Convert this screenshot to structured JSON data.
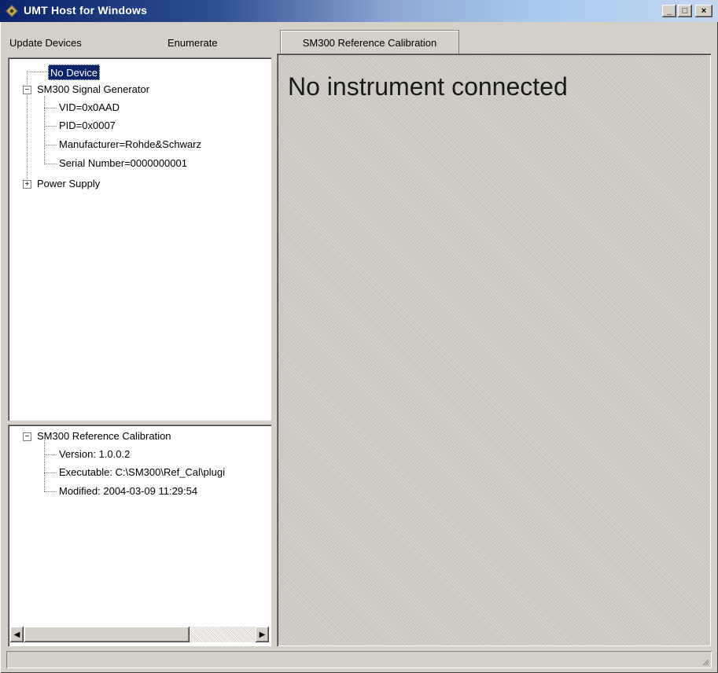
{
  "window": {
    "title": "UMT Host for Windows"
  },
  "title_buttons": {
    "minimize": "_",
    "maximize": "□",
    "close": "×"
  },
  "menu": {
    "update_devices": "Update Devices",
    "enumerate": "Enumerate"
  },
  "tabs": [
    {
      "label": "SM300 Reference Calibration",
      "active": true
    }
  ],
  "device_tree": {
    "selected": "No Device",
    "signal_generator": {
      "label": "SM300 Signal Generator",
      "expander": "−",
      "children": [
        "VID=0x0AAD",
        "PID=0x0007",
        "Manufacturer=Rohde&Schwarz",
        "Serial Number=0000000001"
      ]
    },
    "power_supply": {
      "label": "Power Supply",
      "expander": "+"
    }
  },
  "plugin_tree": {
    "label": "SM300 Reference Calibration",
    "expander": "−",
    "children": [
      "Version: 1.0.0.2",
      "Executable: C:\\SM300\\Ref_Cal\\plugi",
      "Modified: 2004-03-09 11:29:54"
    ]
  },
  "scrollbar": {
    "left_arrow": "◀",
    "right_arrow": "▶"
  },
  "content": {
    "message": "No instrument connected"
  },
  "colors": {
    "selection": "#0a246a",
    "face": "#d4d0c8",
    "titlebar_start": "#0a246a"
  },
  "icons": [
    "app-icon",
    "minimize-icon",
    "maximize-icon",
    "close-icon",
    "scroll-left-icon",
    "scroll-right-icon",
    "size-grip-icon"
  ]
}
